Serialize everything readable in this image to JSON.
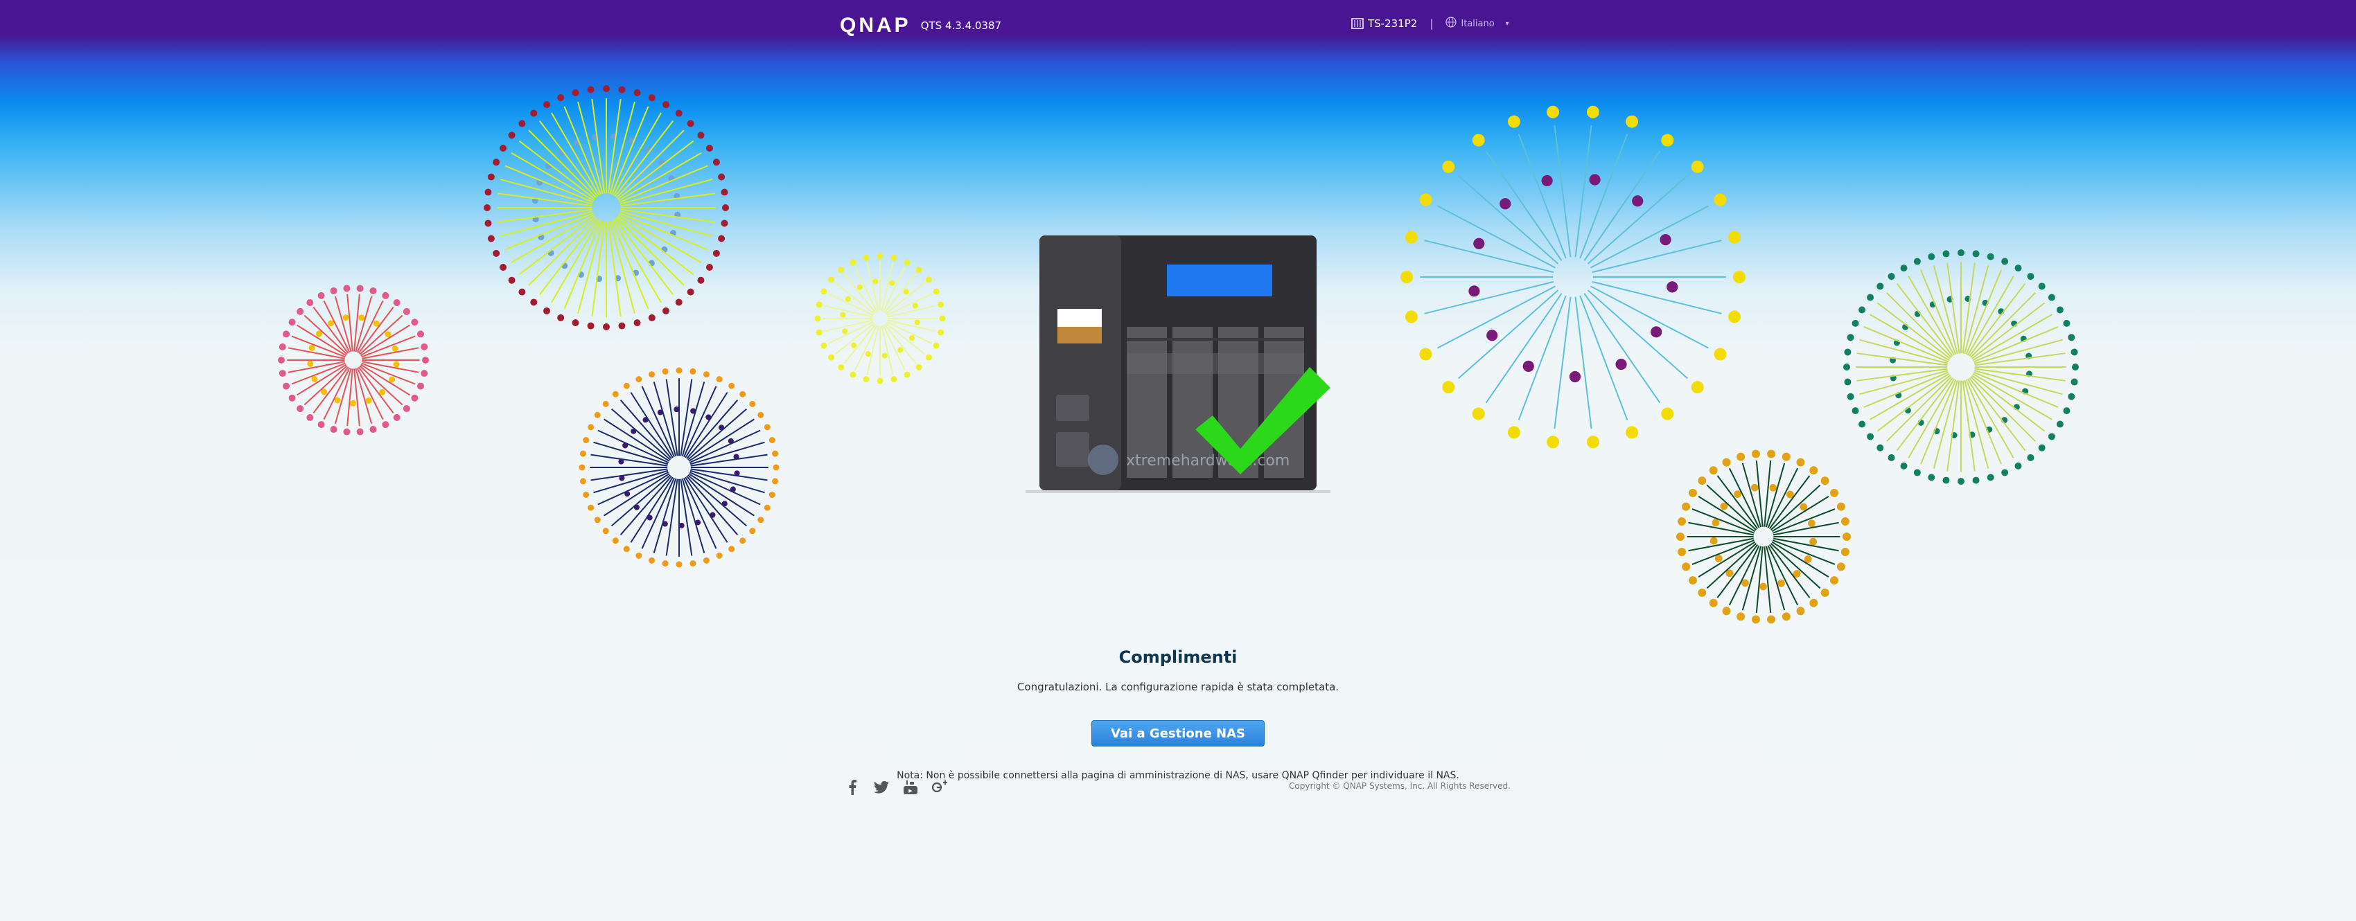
{
  "header": {
    "logo": "QNAP",
    "version": "QTS 4.3.4.0387",
    "model_icon": "nas-device-icon",
    "model": "TS-231P2",
    "language_icon": "globe-icon",
    "language": "Italiano"
  },
  "main": {
    "title": "Complimenti",
    "message": "Congratulazioni. La configurazione rapida è stata completata.",
    "button_label": "Vai a Gestione NAS",
    "note": "Nota: Non è possibile connettersi alla pagina di amministrazione di NAS, usare QNAP Qfinder per individuare il NAS."
  },
  "watermark": "xtremehardware.com",
  "footer": {
    "social": [
      {
        "icon": "facebook-icon"
      },
      {
        "icon": "twitter-icon"
      },
      {
        "icon": "youtube-icon"
      },
      {
        "icon": "google-plus-icon"
      }
    ],
    "copyright": "Copyright © QNAP Systems, Inc. All Rights Reserved."
  },
  "colors": {
    "header_bg": "#4a1592",
    "title": "#10364f",
    "button": "#2b82dc",
    "checkmark": "#2bd81a"
  }
}
